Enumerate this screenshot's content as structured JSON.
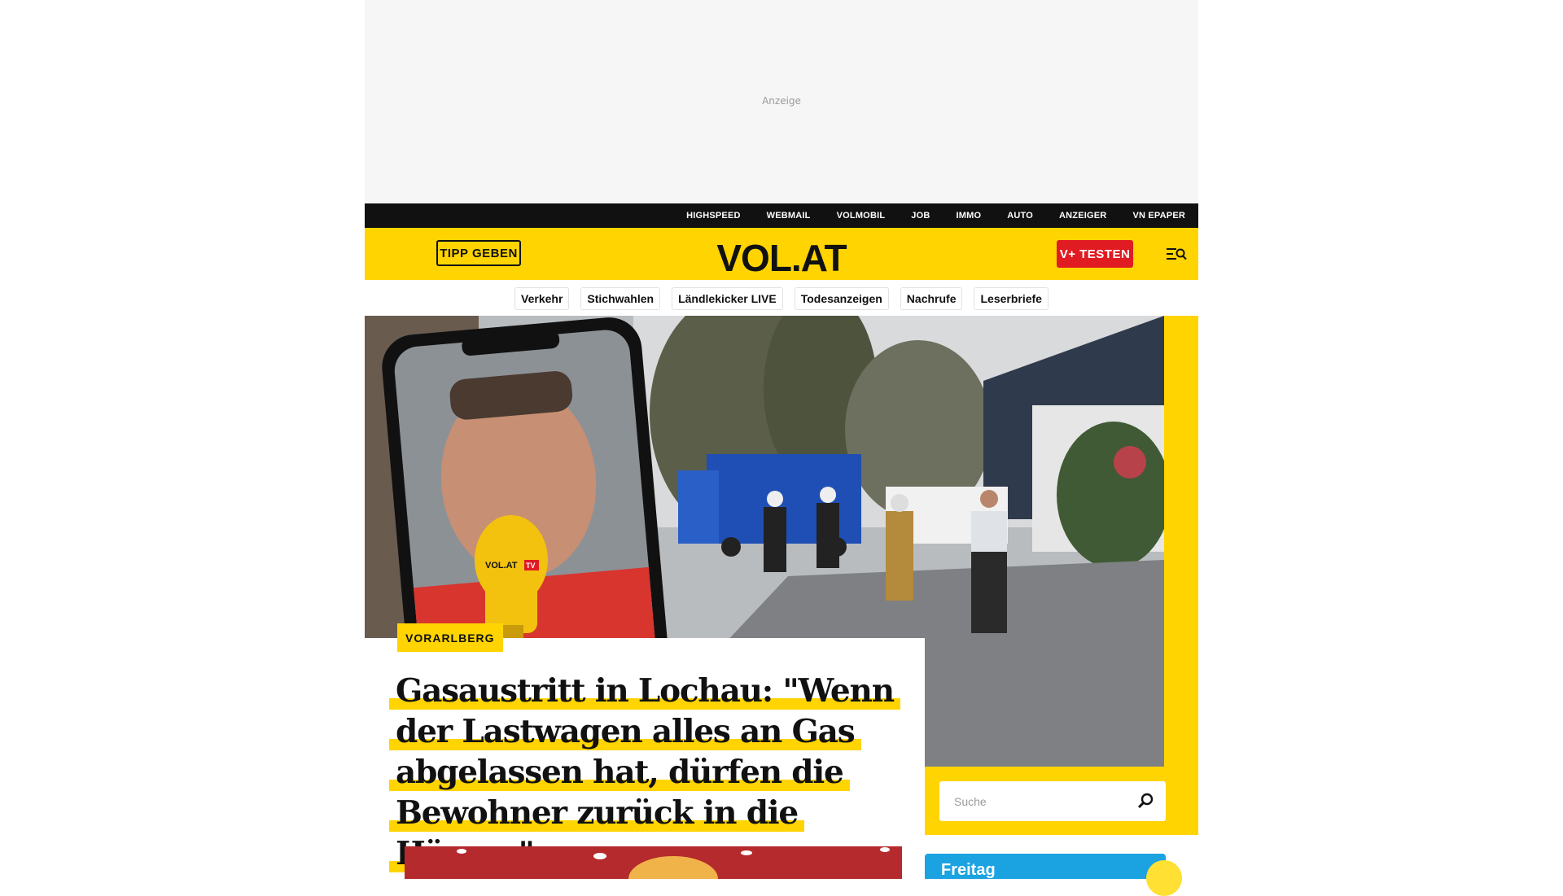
{
  "ad": {
    "label": "Anzeige"
  },
  "topbar": {
    "links": [
      "HIGHSPEED",
      "WEBMAIL",
      "VOLMOBIL",
      "JOB",
      "IMMO",
      "AUTO",
      "ANZEIGER",
      "VN EPAPER"
    ]
  },
  "header": {
    "tipp_label": "TIPP GEBEN",
    "logo": "VOL.AT",
    "vtest_label": "V+ TESTEN",
    "menu_icon": "menu-search-icon"
  },
  "nav": {
    "pills": [
      "Verkehr",
      "Stichwahlen",
      "Ländlekicker LIVE",
      "Todesanzeigen",
      "Nachrufe",
      "Leserbriefe"
    ]
  },
  "hero": {
    "kicker": "VORARLBERG",
    "headline": "Gasaustritt in Lochau: \"Wenn der Lastwagen alles an Gas abgelassen hat, dürfen die Bewohner zurück in die Häuser\"",
    "mic_brand": "VOL.AT",
    "mic_tv": "TV"
  },
  "search": {
    "placeholder": "Suche",
    "icon": "search-icon"
  },
  "weather": {
    "day": "Freitag"
  },
  "colors": {
    "brand_yellow": "#ffd400",
    "accent_red": "#e01b22",
    "topbar_black": "#111111",
    "weather_blue": "#1aa3e0"
  }
}
